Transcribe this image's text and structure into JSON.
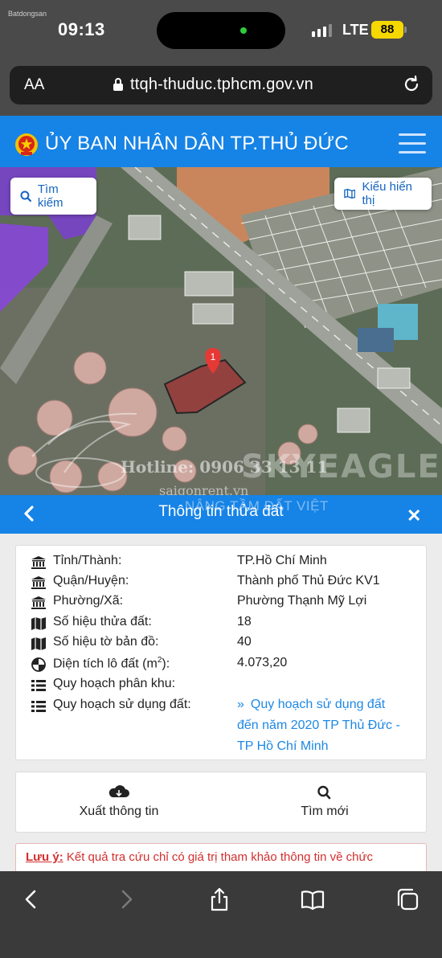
{
  "status_bar": {
    "time": "09:13",
    "network": "LTE",
    "battery": "88",
    "corner_watermark": "Batdongsan"
  },
  "browser": {
    "text_size_label": "AA",
    "url": "ttqh-thuduc.tphcm.gov.vn"
  },
  "site": {
    "title": "ỦY BAN NHÂN DÂN TP.THỦ ĐỨC",
    "brand_color": "#1683e6"
  },
  "map": {
    "search_button": "Tìm kiếm",
    "layer_button": "Kiểu hiển thị",
    "marker_label": "1"
  },
  "watermark": {
    "hotline": "Hotline: 0906 33 13 11",
    "brand": "SKYEAGLE",
    "site": "saigonrent.vn",
    "slogan": "NÂNG TẦM ĐẤT VIỆT"
  },
  "panel": {
    "title": "Thông tin thửa đất"
  },
  "parcel": {
    "rows": [
      {
        "icon": "building-icon",
        "label": "Tỉnh/Thành:",
        "value": "TP.Hồ Chí Minh"
      },
      {
        "icon": "building-icon",
        "label": "Quận/Huyện:",
        "value": "Thành phố Thủ Đức KV1"
      },
      {
        "icon": "building-icon",
        "label": "Phường/Xã:",
        "value": "Phường Thạnh Mỹ Lợi"
      },
      {
        "icon": "map-icon",
        "label": "Số hiệu thửa đất:",
        "value": "18"
      },
      {
        "icon": "map-icon",
        "label": "Số hiệu tờ bản đồ:",
        "value": "40"
      },
      {
        "icon": "area-icon",
        "label": "Diện tích lô đất (m",
        "label_sup": "2",
        "label_end": "):",
        "value": "4.073,20"
      },
      {
        "icon": "list-icon",
        "label": "Quy hoạch phân khu:",
        "value": ""
      },
      {
        "icon": "list-icon",
        "label": "Quy hoạch sử dụng đất:",
        "value": ""
      }
    ],
    "plan_link": {
      "chevron": "»",
      "line1": "Quy hoạch sử dụng đất",
      "line2": "đến năm 2020 TP Thủ Đức -",
      "line3": "TP Hồ Chí Minh"
    }
  },
  "actions": {
    "export": "Xuất thông tin",
    "new_search": "Tìm mới"
  },
  "note": {
    "label": "Lưu ý:",
    "text": "Kết quả tra cứu chỉ có giá trị tham khảo thông tin về chức"
  }
}
